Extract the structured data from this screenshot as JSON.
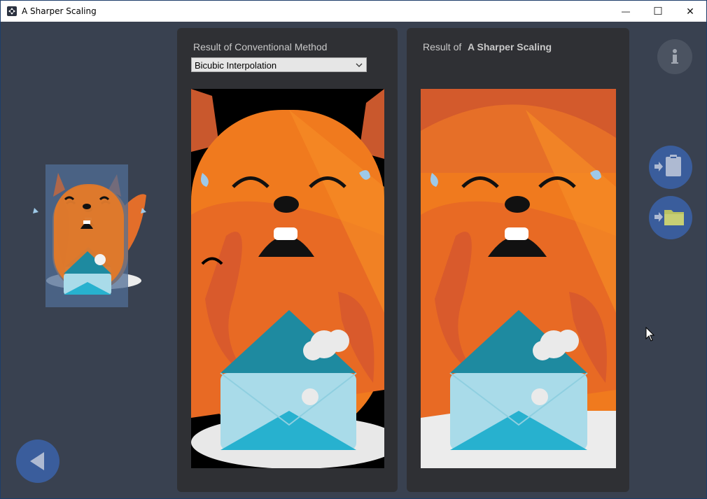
{
  "window": {
    "title": "A Sharper Scaling",
    "minimize_glyph": "—",
    "maximize_glyph": "☐",
    "close_glyph": "✕"
  },
  "left_panel": {
    "label": "Result of Conventional Method",
    "method_select": {
      "selected": "Bicubic Interpolation"
    }
  },
  "right_panel": {
    "label_prefix": "Result of",
    "label_app": "A Sharper Scaling"
  },
  "icons": {
    "info": "info-icon",
    "paste": "clipboard-paste-icon",
    "open": "folder-open-icon",
    "back": "back-arrow-icon"
  },
  "colors": {
    "background": "#394150",
    "panel": "#2f3034",
    "button_blue": "#3a5d9c",
    "button_gray": "#4b5361",
    "accent_orange": "#f07a1e"
  }
}
